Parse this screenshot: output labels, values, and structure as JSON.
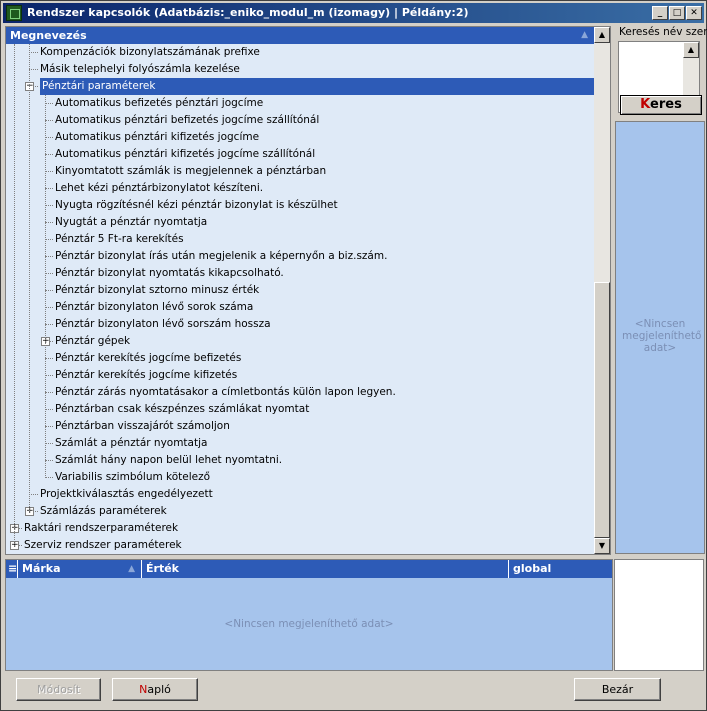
{
  "window": {
    "title": "Rendszer kapcsolók   (Adatbázis:_eniko_modul_m (izomagy) | Példány:2)"
  },
  "tree": {
    "column_header": "Megnevezés",
    "items": [
      {
        "label": "Kompenzációk bizonylatszámának prefixe",
        "level": 2,
        "expander": ""
      },
      {
        "label": "Másik telephelyi folyószámla kezelése",
        "level": 2,
        "expander": ""
      },
      {
        "label": "Pénztári paraméterek",
        "level": 2,
        "expander": "−",
        "selected": true
      },
      {
        "label": "Automatikus befizetés pénztári jogcíme",
        "level": 3,
        "expander": ""
      },
      {
        "label": "Automatikus pénztári befizetés jogcíme szállítónál",
        "level": 3,
        "expander": ""
      },
      {
        "label": "Automatikus pénztári kifizetés jogcíme",
        "level": 3,
        "expander": ""
      },
      {
        "label": "Automatikus pénztári kifizetés jogcíme szállítónál",
        "level": 3,
        "expander": ""
      },
      {
        "label": "Kinyomtatott számlák is megjelennek a pénztárban",
        "level": 3,
        "expander": ""
      },
      {
        "label": "Lehet kézi pénztárbizonylatot készíteni.",
        "level": 3,
        "expander": ""
      },
      {
        "label": "Nyugta rögzítésnél kézi pénztár bizonylat is készülhet",
        "level": 3,
        "expander": ""
      },
      {
        "label": "Nyugtát a pénztár nyomtatja",
        "level": 3,
        "expander": ""
      },
      {
        "label": "Pénztár 5 Ft-ra kerekítés",
        "level": 3,
        "expander": ""
      },
      {
        "label": "Pénztár bizonylat írás után megjelenik a képernyőn a biz.szám.",
        "level": 3,
        "expander": ""
      },
      {
        "label": "Pénztár bizonylat nyomtatás kikapcsolható.",
        "level": 3,
        "expander": ""
      },
      {
        "label": "Pénztár bizonylat sztorno minusz érték",
        "level": 3,
        "expander": ""
      },
      {
        "label": "Pénztár bizonylaton lévő sorok száma",
        "level": 3,
        "expander": ""
      },
      {
        "label": "Pénztár bizonylaton lévő sorszám hossza",
        "level": 3,
        "expander": ""
      },
      {
        "label": "Pénztár gépek",
        "level": 3,
        "expander": "+"
      },
      {
        "label": "Pénztár kerekítés jogcíme befizetés",
        "level": 3,
        "expander": ""
      },
      {
        "label": "Pénztár kerekítés jogcíme kifizetés",
        "level": 3,
        "expander": ""
      },
      {
        "label": "Pénztár zárás nyomtatásakor a címletbontás külön lapon legyen.",
        "level": 3,
        "expander": ""
      },
      {
        "label": "Pénztárban csak készpénzes számlákat nyomtat",
        "level": 3,
        "expander": ""
      },
      {
        "label": "Pénztárban visszajárót számoljon",
        "level": 3,
        "expander": ""
      },
      {
        "label": "Számlát a pénztár nyomtatja",
        "level": 3,
        "expander": ""
      },
      {
        "label": "Számlát hány napon belül lehet nyomtatni.",
        "level": 3,
        "expander": ""
      },
      {
        "label": "Variabilis szimbólum kötelező",
        "level": 3,
        "expander": ""
      },
      {
        "label": "Projektkiválasztás engedélyezett",
        "level": 2,
        "expander": ""
      },
      {
        "label": "Számlázás paraméterek",
        "level": 2,
        "expander": "+"
      },
      {
        "label": "Raktári rendszerparaméterek",
        "level": 1,
        "expander": "+"
      },
      {
        "label": "Szerviz rendszer paraméterek",
        "level": 1,
        "expander": "+"
      }
    ]
  },
  "search": {
    "caption": "Keresés név szerint",
    "button_prefix": "K",
    "button_rest": "eres",
    "empty_text": "<Nincsen megjeleníthető adat>"
  },
  "grid": {
    "columns": [
      "Márka",
      "Érték",
      "global"
    ],
    "empty_text": "<Nincsen megjeleníthető adat>"
  },
  "buttons": {
    "modify": "Módosít",
    "log_accel": "N",
    "log_rest": "apló",
    "close": "Bezár"
  }
}
